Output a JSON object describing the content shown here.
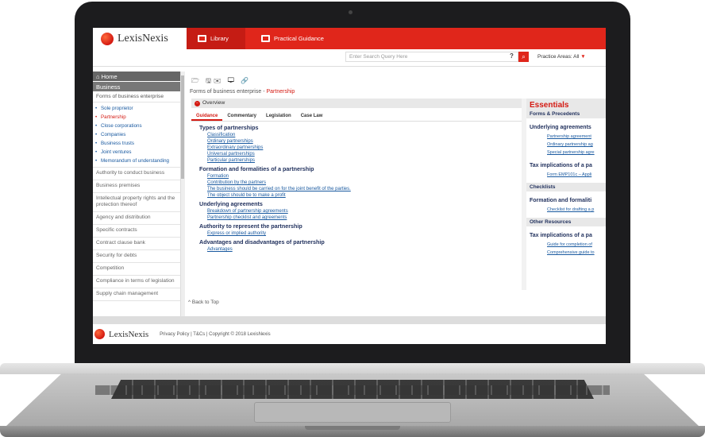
{
  "header": {
    "logo": "LexisNexis",
    "tabs": [
      {
        "label": "Library"
      },
      {
        "label": "Practical Guidance"
      }
    ],
    "search_placeholder": "Enter Search Query Here",
    "help": "?",
    "practice_areas": "Practice Areas: All"
  },
  "sidebar": {
    "home": "Home",
    "business": "Business",
    "section": "Forms of business enterprise",
    "subitems": [
      "Sole proprietor",
      "Partnership",
      "Close corporations",
      "Companies",
      "Business trusts",
      "Joint ventures",
      "Memorandum of understanding"
    ],
    "items": [
      "Authority to conduct business",
      "Business premises",
      "Intellectual property rights and the protection thereof",
      "Agency and distribution",
      "Specific contracts",
      "Contract clause bank",
      "Security for debts",
      "Competition",
      "Compliance in terms of legislation",
      "Supply chain management"
    ]
  },
  "main": {
    "toolbar": "🗁 🖫✉ 🖵  🔗",
    "breadcrumb_prefix": "Forms of business enterprise - ",
    "breadcrumb_current": "Partnership",
    "overview": "Overview",
    "tabs": [
      "Guidance",
      "Commentary",
      "Legislation",
      "Case Law"
    ],
    "sections": [
      {
        "heading": "Types of partnerships",
        "links": [
          "Classification",
          "Ordinary partnerships",
          "Extraordinary partnerships",
          "Universal partnerships",
          "Particular partnerships"
        ]
      },
      {
        "heading": "Formation and formalities of a partnership",
        "links": [
          "Formation",
          "Contribution by the partners",
          "The business should be carried on for the joint benefit of the parties.",
          "The object should be to make a profit"
        ]
      },
      {
        "heading": "Underlying agreements",
        "links": [
          "Breakdown of partnership agreements",
          "Partnership checklist and agreements"
        ]
      },
      {
        "heading": "Authority to represent the partnership",
        "links": [
          "Express or implied authority"
        ]
      },
      {
        "heading": "Advantages and disadvantages of partnership",
        "links": [
          "Advantages"
        ]
      }
    ],
    "back_to_top": "^ Back to Top"
  },
  "essentials": {
    "title": "Essentials",
    "forms_precedents": "Forms & Precedents",
    "underlying_heading": "Underlying agreements",
    "underlying_links": [
      "Partnership agreement",
      "Ordinary partnership ag",
      "Special partnership agre"
    ],
    "tax_heading": "Tax implications of a pa",
    "tax_links": [
      "Form EMP101c – Appli"
    ],
    "checklists": "Checklists",
    "formation_heading": "Formation and formaliti",
    "formation_links": [
      "Checklist for drafting a p"
    ],
    "other_resources": "Other Resources",
    "tax2_heading": "Tax implications of a pa",
    "tax2_links": [
      "Guide for completion of",
      "Comprehensive guide to"
    ]
  },
  "footer": {
    "logo": "LexisNexis",
    "links": "Privacy Policy | T&Cs | Copyright © 2018 LexisNexis"
  },
  "colors": {
    "brand_red": "#e0261b",
    "link_blue": "#1a5aa0",
    "heading_navy": "#1f2f5c"
  }
}
